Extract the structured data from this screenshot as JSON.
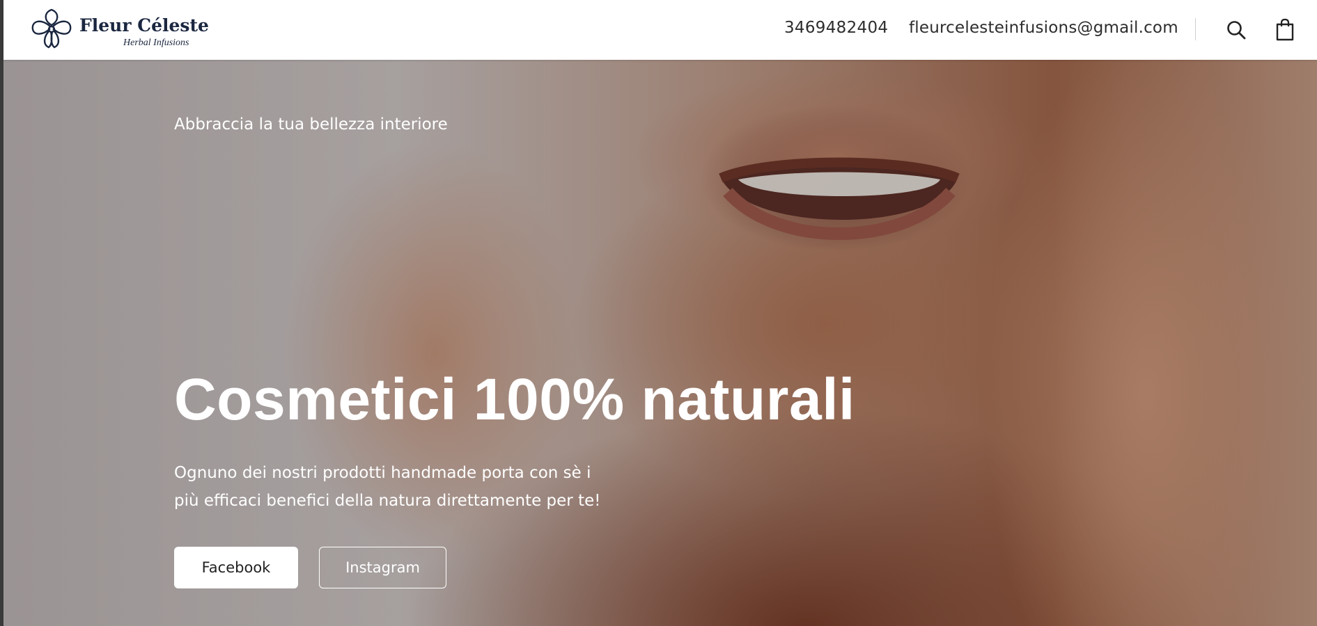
{
  "header": {
    "logo": {
      "title": "Fleur Céleste",
      "subtitle": "Herbal Infusions"
    },
    "phone": "3469482404",
    "email": "fleurcelesteinfusions@gmail.com",
    "icons": {
      "search": "search-icon",
      "cart": "shopping-bag-icon"
    },
    "brand_color": "#1b2740"
  },
  "hero": {
    "eyebrow": "Abbraccia la tua bellezza interiore",
    "headline": "Cosmetici 100% naturali",
    "description": "Ognuno dei nostri prodotti handmade porta con sè i più efficaci benefici della natura direttamente per te!",
    "buttons": {
      "facebook": "Facebook",
      "instagram": "Instagram"
    },
    "text_color": "#ffffff"
  }
}
